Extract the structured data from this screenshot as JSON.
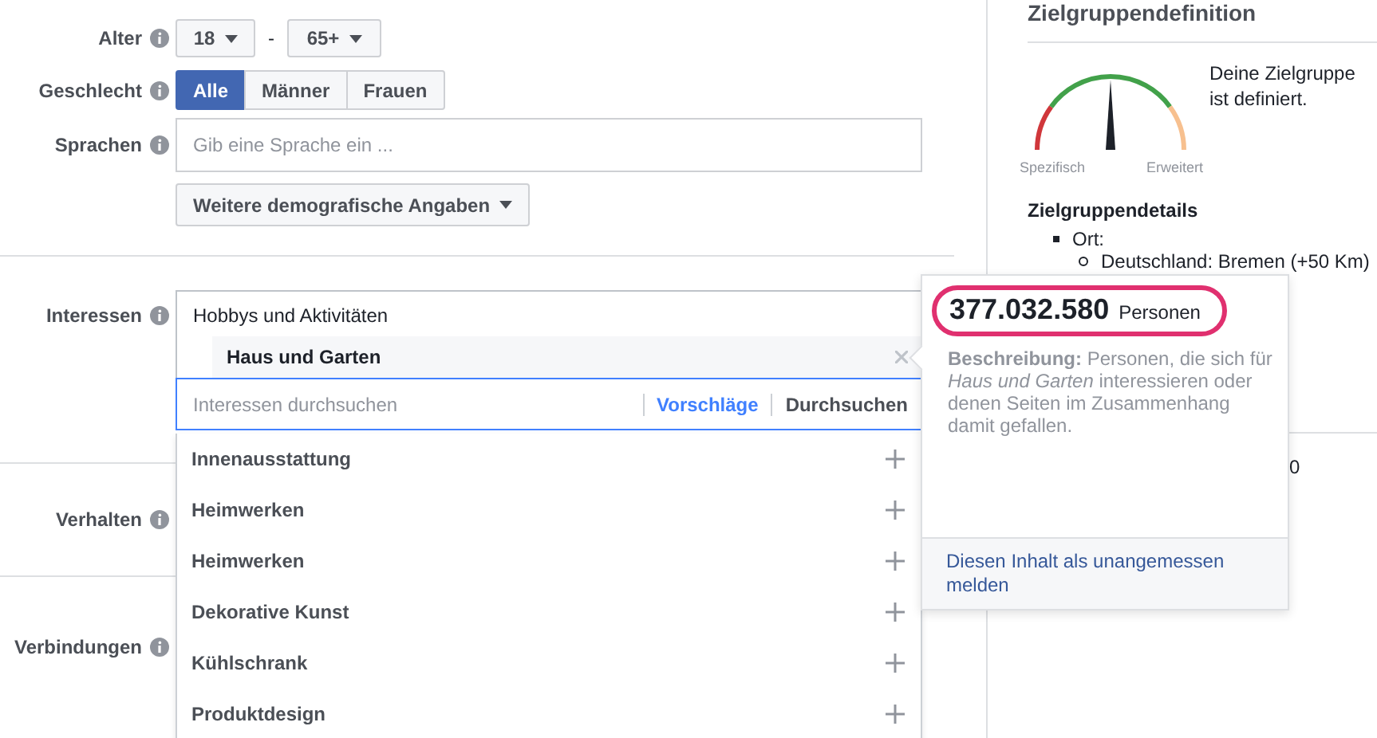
{
  "demographics": {
    "age": {
      "label": "Alter",
      "from": "18",
      "separator": "-",
      "to": "65+"
    },
    "gender": {
      "label": "Geschlecht",
      "options": [
        {
          "label": "Alle",
          "selected": true
        },
        {
          "label": "Männer",
          "selected": false
        },
        {
          "label": "Frauen",
          "selected": false
        }
      ]
    },
    "languages": {
      "label": "Sprachen",
      "placeholder": "Gib eine Sprache ein ..."
    },
    "more_button": "Weitere demografische Angaben"
  },
  "interests": {
    "label": "Interessen",
    "category": "Hobbys und Aktivitäten",
    "selected_item": "Haus und Garten",
    "search": {
      "placeholder": "Interessen durchsuchen"
    },
    "modes": [
      {
        "label": "Vorschläge",
        "selected": true
      },
      {
        "label": "Durchsuchen",
        "selected": false
      }
    ],
    "suggestions": [
      "Innenausstattung",
      "Heimwerken",
      "Heimwerken",
      "Dekorative Kunst",
      "Kühlschrank",
      "Produktdesign"
    ]
  },
  "behaviors": {
    "label": "Verhalten"
  },
  "connections": {
    "label": "Verbindungen"
  },
  "popup": {
    "count": "377.032.580",
    "unit": "Personen",
    "description": "**Beschreibung:** Personen, die sich für *Haus und Garten* interessieren oder denen Seiten im Zusammenhang damit gefallen.",
    "report_link": "Diesen Inhalt als unangemessen melden"
  },
  "audience_panel": {
    "title": "Zielgruppendefinition",
    "gauge": {
      "level": 0.5,
      "left_label": "Spezifisch",
      "right_label": "Erweitert"
    },
    "status": "Deine Zielgruppe ist definiert.",
    "details_title": "Zielgruppendetails",
    "details": [
      {
        "text": "Ort:",
        "children": [
          {
            "text": "Deutschland: Bremen (+50 Km)"
          }
        ]
      }
    ],
    "cut_text": "0"
  }
}
